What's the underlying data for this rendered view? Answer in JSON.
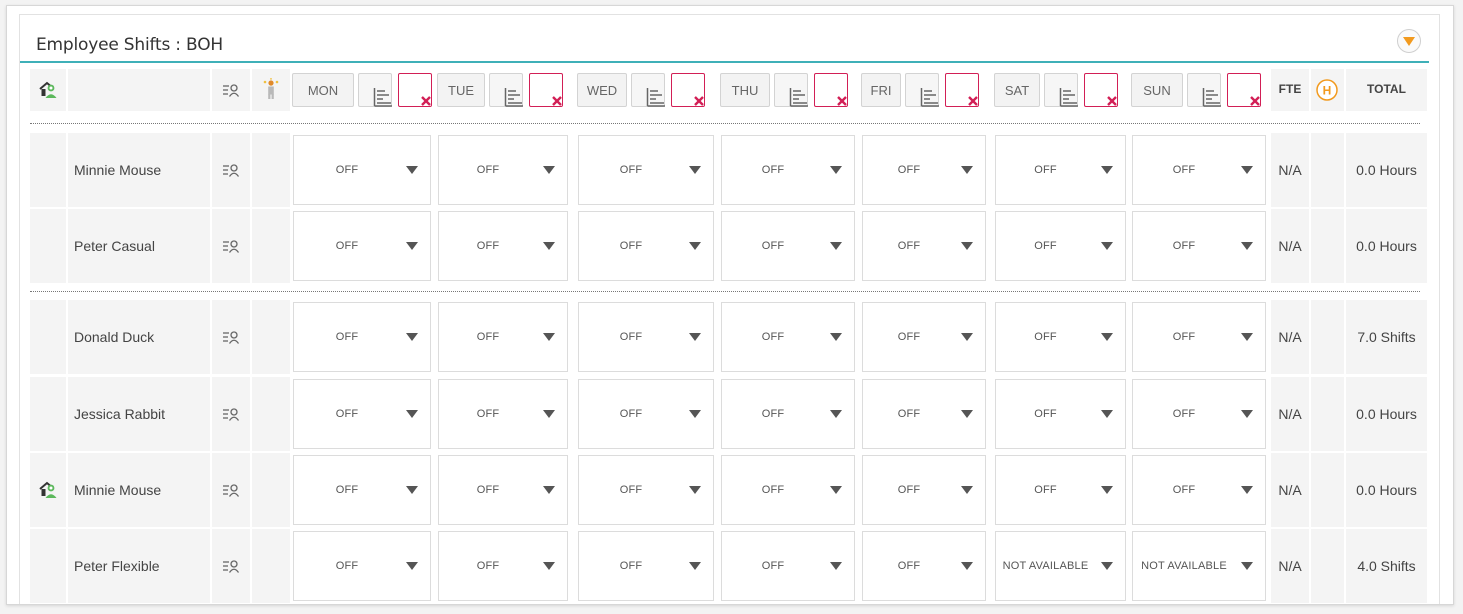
{
  "panel": {
    "title": "Employee Shifts : BOH"
  },
  "header": {
    "days": [
      {
        "label": "MON"
      },
      {
        "label": "TUE"
      },
      {
        "label": "WED"
      },
      {
        "label": "THU"
      },
      {
        "label": "FRI"
      },
      {
        "label": "SAT"
      },
      {
        "label": "SUN"
      }
    ],
    "fte_label": "FTE",
    "holiday_label": "H",
    "total_label": "TOTAL"
  },
  "groups": [
    {
      "rows": [
        {
          "name": "Minnie Mouse",
          "manager": false,
          "shifts": [
            "OFF",
            "OFF",
            "OFF",
            "OFF",
            "OFF",
            "OFF",
            "OFF"
          ],
          "fte": "N/A",
          "total": "0.0 Hours"
        },
        {
          "name": "Peter Casual",
          "manager": false,
          "shifts": [
            "OFF",
            "OFF",
            "OFF",
            "OFF",
            "OFF",
            "OFF",
            "OFF"
          ],
          "fte": "N/A",
          "total": "0.0 Hours"
        }
      ]
    },
    {
      "rows": [
        {
          "name": "Donald Duck",
          "manager": false,
          "shifts": [
            "OFF",
            "OFF",
            "OFF",
            "OFF",
            "OFF",
            "OFF",
            "OFF"
          ],
          "fte": "N/A",
          "total": "7.0 Shifts"
        },
        {
          "name": "Jessica Rabbit",
          "manager": false,
          "shifts": [
            "OFF",
            "OFF",
            "OFF",
            "OFF",
            "OFF",
            "OFF",
            "OFF"
          ],
          "fte": "N/A",
          "total": "0.0 Hours"
        },
        {
          "name": "Minnie Mouse",
          "manager": true,
          "shifts": [
            "OFF",
            "OFF",
            "OFF",
            "OFF",
            "OFF",
            "OFF",
            "OFF"
          ],
          "fte": "N/A",
          "total": "0.0 Hours"
        },
        {
          "name": "Peter Flexible",
          "manager": false,
          "shifts": [
            "OFF",
            "OFF",
            "OFF",
            "OFF",
            "OFF",
            "NOT AVAILABLE",
            "NOT AVAILABLE"
          ],
          "fte": "N/A",
          "total": "4.0 Shifts"
        }
      ]
    }
  ],
  "colors": {
    "accent": "#3fb0b8",
    "clear_red": "#d21f56",
    "holiday_orange": "#f29a1e",
    "manager_green": "#5cb85c"
  },
  "icons": {
    "manager": "manager-home-icon",
    "profile": "employee-profile-icon",
    "availability": "availability-person-icon",
    "sort": "sort-bars-icon",
    "clear": "clear-x-icon",
    "holiday": "holiday-h-icon",
    "collapse": "collapse-arrow-icon"
  }
}
